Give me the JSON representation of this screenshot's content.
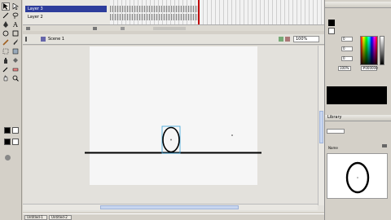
{
  "timeline": {
    "layers": [
      {
        "name": "Layer 3",
        "active": true
      },
      {
        "name": "Layer 2",
        "active": false
      }
    ]
  },
  "edit_bar": {
    "scene": "Scene 1",
    "zoom": "100%"
  },
  "color_mixer": {
    "hex": "#000000",
    "alpha": "100%",
    "channels": [
      "0",
      "0",
      "0"
    ]
  },
  "library": {
    "title": "Library",
    "preview_label": "Name"
  },
  "status_bar": {
    "tabs": [
      "Untitled-1",
      "Untitled-2"
    ]
  },
  "colors": {
    "stage_bg": "#f6f6f6",
    "pasteboard": "#e3e1dc",
    "selection": "#35a0d8",
    "layer_active": "#2e3d9c"
  },
  "icons": [
    "arrow-icon",
    "subselect-icon",
    "line-icon",
    "lasso-icon",
    "pen-icon",
    "text-icon",
    "oval-icon",
    "rectangle-icon",
    "pencil-icon",
    "brush-icon",
    "free-transform-icon",
    "fill-transform-icon",
    "ink-bottle-icon",
    "paint-bucket-icon",
    "eyedropper-icon",
    "eraser-icon",
    "hand-icon",
    "zoom-icon"
  ]
}
